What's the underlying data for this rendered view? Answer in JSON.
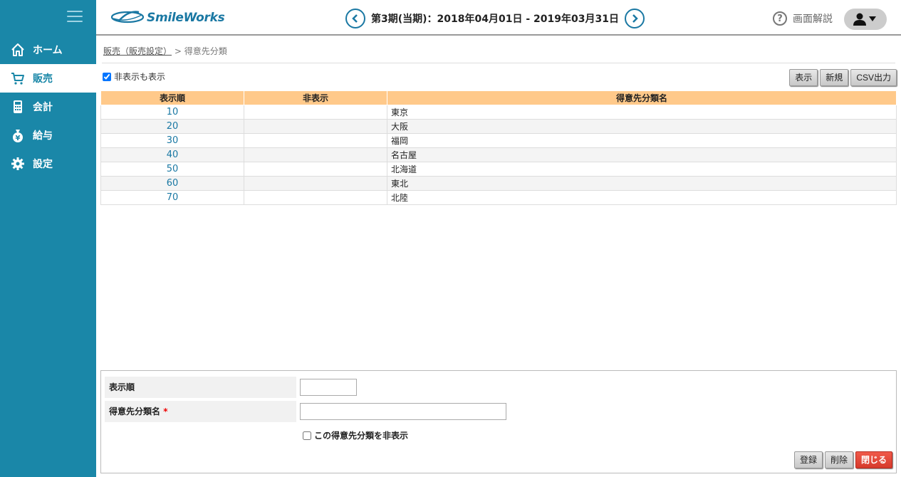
{
  "sidebar": {
    "items": [
      {
        "label": "ホーム",
        "icon": "home-icon"
      },
      {
        "label": "販売",
        "icon": "cart-icon"
      },
      {
        "label": "会計",
        "icon": "calculator-icon"
      },
      {
        "label": "給与",
        "icon": "moneybag-icon"
      },
      {
        "label": "設定",
        "icon": "gear-icon"
      }
    ],
    "active_index": 1,
    "color": "#1a87a8"
  },
  "header": {
    "logo_text": "SmileWorks",
    "period": "第3期(当期)：2018年04月01日 - 2019年03月31日",
    "help_label": "画面解説"
  },
  "breadcrumb": {
    "link": "販売（販売設定）",
    "separator": " > ",
    "current": "得意先分類"
  },
  "show_hidden_label": "非表示も表示",
  "show_hidden_checked": true,
  "toolbar": {
    "display_label": "表示",
    "new_label": "新規",
    "csv_label": "CSV出力"
  },
  "table": {
    "headers": [
      "表示順",
      "非表示",
      "得意先分類名"
    ],
    "rows": [
      {
        "order": "10",
        "hidden": "",
        "name": "東京"
      },
      {
        "order": "20",
        "hidden": "",
        "name": "大阪"
      },
      {
        "order": "30",
        "hidden": "",
        "name": "福岡"
      },
      {
        "order": "40",
        "hidden": "",
        "name": "名古屋"
      },
      {
        "order": "50",
        "hidden": "",
        "name": "北海道"
      },
      {
        "order": "60",
        "hidden": "",
        "name": "東北"
      },
      {
        "order": "70",
        "hidden": "",
        "name": "北陸"
      }
    ],
    "header_color": "#ffc98a"
  },
  "form": {
    "order_label": "表示順",
    "order_value": "",
    "name_label": "得意先分類名",
    "required_mark": "*",
    "name_value": "",
    "hide_label": "この得意先分類を非表示",
    "register_label": "登録",
    "delete_label": "削除",
    "close_label": "閉じる"
  }
}
